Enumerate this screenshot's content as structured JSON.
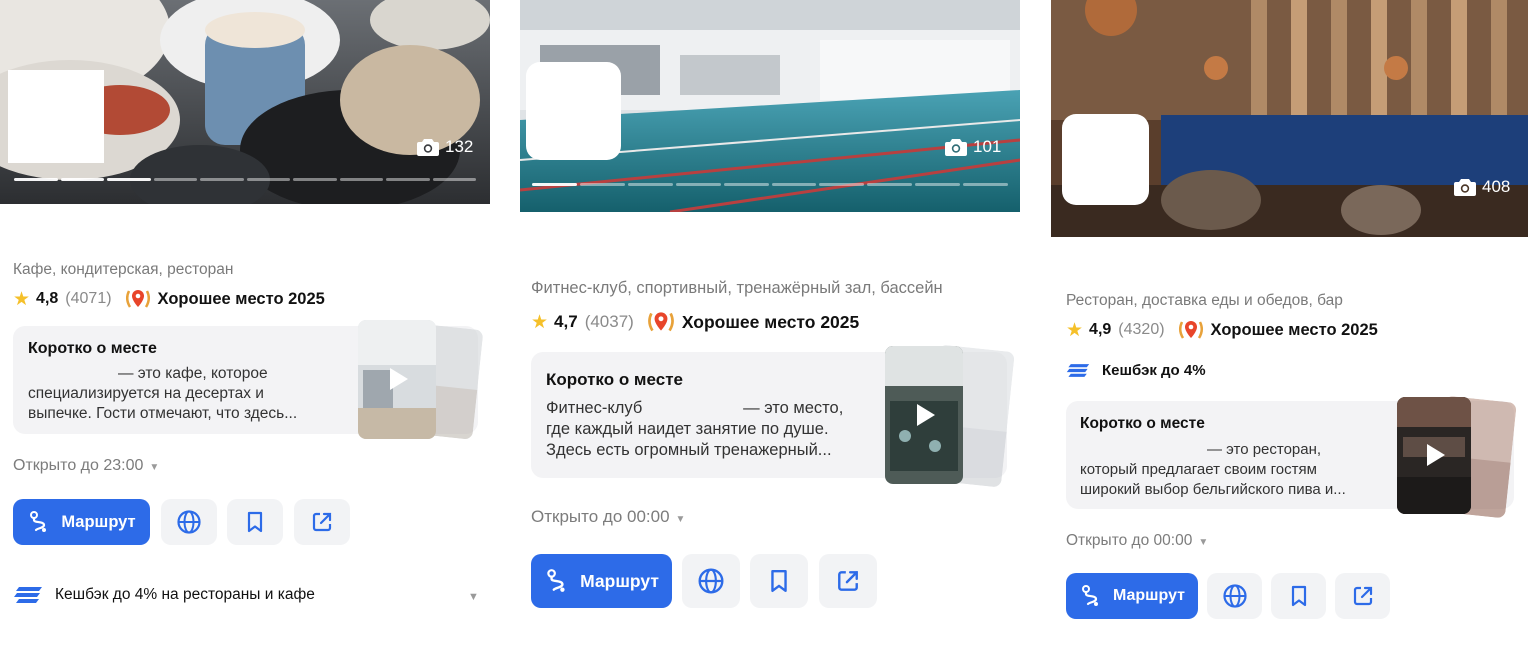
{
  "colors": {
    "accent": "#2d6be8",
    "star": "#f5c02a",
    "award": "#e8752a",
    "chip": "#f2f3f5"
  },
  "icons": {
    "camera": "camera-icon",
    "route": "route-icon",
    "globe": "globe-icon",
    "bookmark": "bookmark-icon",
    "share": "share-icon",
    "cashback": "cashback-stripes-icon",
    "play": "play-icon",
    "star": "star-icon",
    "award": "award-laurel-pin-icon"
  },
  "cards": [
    {
      "photo_count": "132",
      "category": "Кафе, кондитерская, ресторан",
      "rating": "4,8",
      "reviews": "(4071)",
      "award": "Хорошее место 2025",
      "about_title": "Коротко о месте",
      "about_lines": [
        "— это кафе, которое",
        "специализируется на десертах и",
        "выпечке. Гости отмечают, что здесь..."
      ],
      "open": "Открыто до 23:00",
      "route": "Маршрут",
      "cashback": "Кешбэк до 4% на рестораны и кафе"
    },
    {
      "photo_count": "101",
      "category": "Фитнес-клуб, спортивный, тренажёрный зал, бассейн",
      "rating": "4,7",
      "reviews": "(4037)",
      "award": "Хорошее место 2025",
      "about_title": "Коротко о месте",
      "about_lines": [
        "Фитнес-клуб                      — это место,",
        "где каждый наидет занятие по душе.",
        "Здесь есть огромный тренажерный..."
      ],
      "open": "Открыто до 00:00",
      "route": "Маршрут"
    },
    {
      "photo_count": "408",
      "category": "Ресторан, доставка еды и обедов, бар",
      "rating": "4,9",
      "reviews": "(4320)",
      "award": "Хорошее место 2025",
      "cashback": "Кешбэк до 4%",
      "about_title": "Коротко о месте",
      "about_lines": [
        "— это ресторан,",
        "который предлагает своим гостям",
        "широкий выбор бельгийского пива и..."
      ],
      "open": "Открыто до 00:00",
      "route": "Маршрут"
    }
  ]
}
